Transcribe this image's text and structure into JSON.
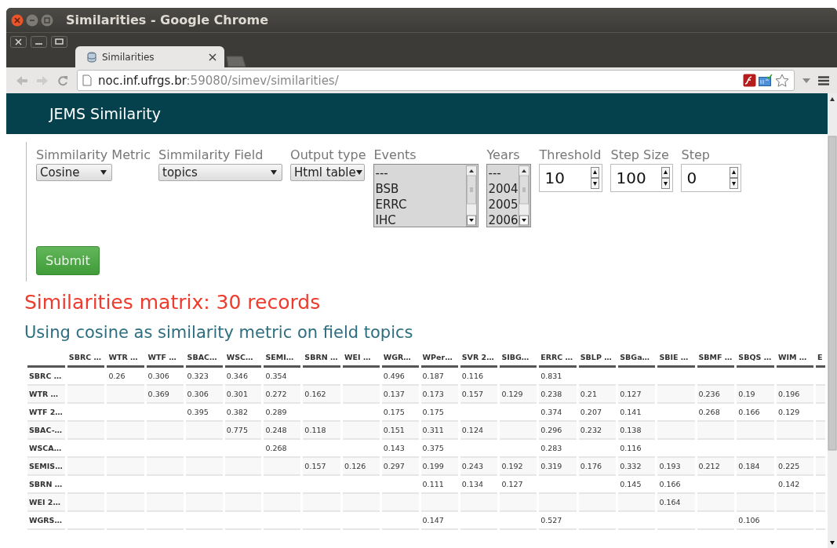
{
  "window": {
    "title": "Similarities - Google Chrome"
  },
  "tabs": [
    {
      "label": "Similarities",
      "selected": true
    }
  ],
  "address_bar": {
    "host": "noc.inf.ufrgs.br",
    "path": ":59080/simev/similarities/"
  },
  "page": {
    "brand": "JEMS Similarity",
    "form": {
      "fields": [
        {
          "kind": "select",
          "label": "Simmilarity Metric",
          "value": "Cosine"
        },
        {
          "kind": "select",
          "label": "Simmilarity Field",
          "value": "topics"
        },
        {
          "kind": "select",
          "label": "Output type",
          "value": "Html table"
        },
        {
          "kind": "listbox",
          "label": "Events",
          "options": [
            "---",
            "BSB",
            "ERRC",
            "IHC"
          ]
        },
        {
          "kind": "listbox",
          "label": "Years",
          "options": [
            "---",
            "2004",
            "2005",
            "2006"
          ]
        },
        {
          "kind": "number",
          "label": "Threshold",
          "value": "10"
        },
        {
          "kind": "number",
          "label": "Step Size",
          "value": "100"
        },
        {
          "kind": "number",
          "label": "Step",
          "value": "0"
        }
      ],
      "submit": "Submit"
    },
    "heading": "Similarities matrix: 30 records",
    "subheading": "Using cosine as similarity metric on field topics",
    "table": {
      "columns": [
        "SBRC …",
        "WTR …",
        "WTF …",
        "SBAC…",
        "WSC…",
        "SEMI…",
        "SBRN …",
        "WEI …",
        "WGR…",
        "WPer…",
        "SVR 2…",
        "SIBG…",
        "ERRC …",
        "SBLP …",
        "SBGa…",
        "SBIE …",
        "SBMF …",
        "SBQS …",
        "WIM …",
        "E"
      ],
      "rows": [
        {
          "label": "SBRC …",
          "cells": [
            null,
            "0.26",
            "0.306",
            "0.323",
            "0.346",
            "0.354",
            null,
            null,
            "0.496",
            "0.187",
            "0.116",
            null,
            "0.831",
            null,
            null,
            null,
            null,
            null,
            null,
            null
          ]
        },
        {
          "label": "WTR …",
          "cells": [
            null,
            null,
            "0.369",
            "0.306",
            "0.301",
            "0.272",
            "0.162",
            null,
            "0.137",
            "0.173",
            "0.157",
            "0.129",
            "0.238",
            "0.21",
            "0.127",
            null,
            "0.236",
            "0.19",
            "0.196",
            null
          ]
        },
        {
          "label": "WTF 2…",
          "cells": [
            null,
            null,
            null,
            "0.395",
            "0.382",
            "0.289",
            null,
            null,
            "0.175",
            "0.175",
            null,
            null,
            "0.374",
            "0.207",
            "0.141",
            null,
            "0.268",
            "0.166",
            "0.129",
            null
          ]
        },
        {
          "label": "SBAC-…",
          "cells": [
            null,
            null,
            null,
            null,
            "0.775",
            "0.248",
            "0.118",
            null,
            "0.151",
            "0.311",
            "0.124",
            null,
            "0.296",
            "0.232",
            "0.138",
            null,
            null,
            null,
            null,
            null
          ]
        },
        {
          "label": "WSCA…",
          "cells": [
            null,
            null,
            null,
            null,
            null,
            "0.268",
            null,
            null,
            "0.143",
            "0.375",
            null,
            null,
            "0.283",
            null,
            "0.116",
            null,
            null,
            null,
            null,
            null
          ]
        },
        {
          "label": "SEMIS…",
          "cells": [
            null,
            null,
            null,
            null,
            null,
            null,
            "0.157",
            "0.126",
            "0.297",
            "0.199",
            "0.243",
            "0.192",
            "0.319",
            "0.176",
            "0.332",
            "0.193",
            "0.212",
            "0.184",
            "0.225",
            null
          ]
        },
        {
          "label": "SBRN …",
          "cells": [
            null,
            null,
            null,
            null,
            null,
            null,
            null,
            null,
            null,
            "0.111",
            "0.134",
            "0.127",
            null,
            null,
            "0.145",
            "0.166",
            null,
            null,
            "0.142",
            null
          ]
        },
        {
          "label": "WEI 2…",
          "cells": [
            null,
            null,
            null,
            null,
            null,
            null,
            null,
            null,
            null,
            null,
            null,
            null,
            null,
            null,
            null,
            "0.164",
            null,
            null,
            null,
            null
          ]
        },
        {
          "label": "WGRS…",
          "cells": [
            null,
            null,
            null,
            null,
            null,
            null,
            null,
            null,
            null,
            "0.147",
            null,
            null,
            "0.527",
            null,
            null,
            null,
            null,
            "0.106",
            null,
            null
          ]
        }
      ]
    }
  }
}
